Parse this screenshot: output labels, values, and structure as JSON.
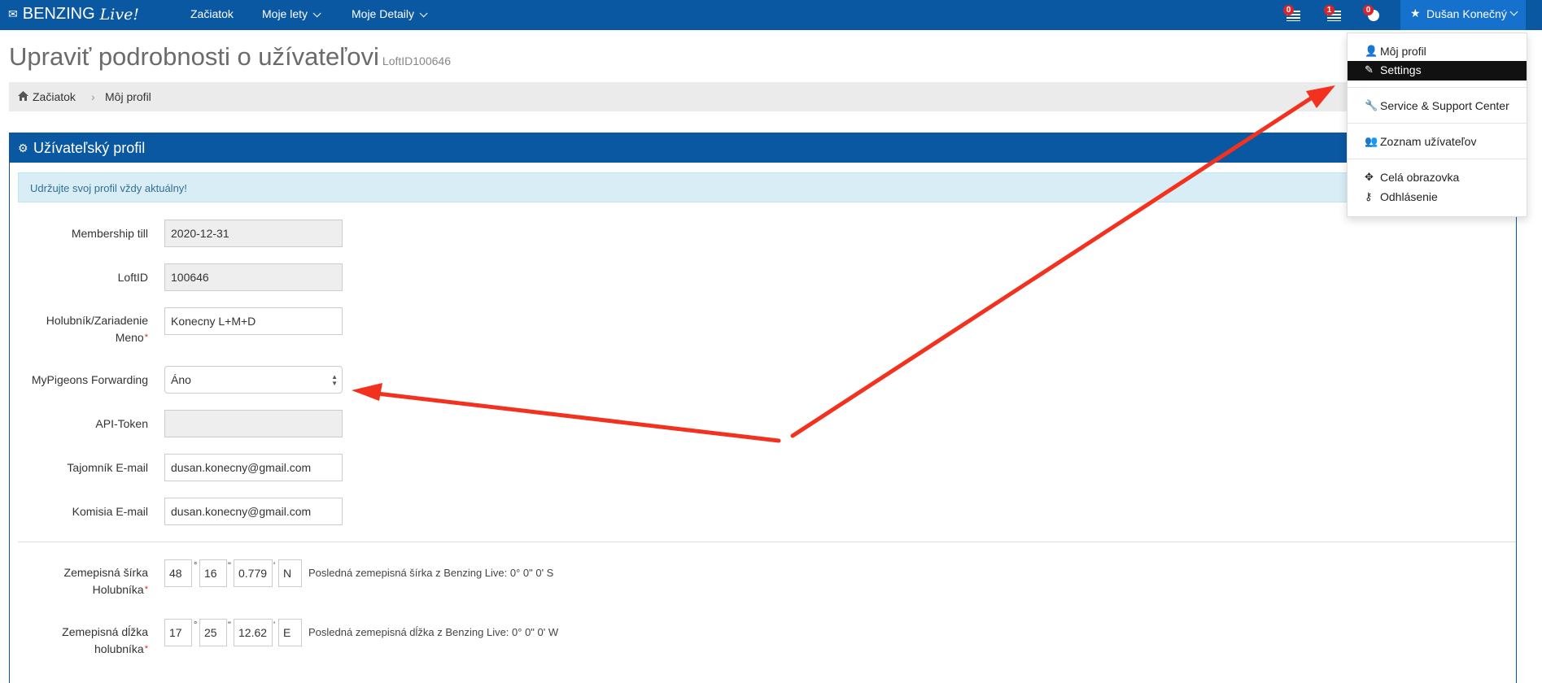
{
  "navbar": {
    "brand": "BENZING",
    "brand_script": "Live!",
    "links": [
      {
        "label": "Začiatok"
      },
      {
        "label": "Moje lety"
      },
      {
        "label": "Moje Detaily"
      }
    ],
    "badges": [
      "0",
      "1",
      "0"
    ],
    "user_name": "Dušan Konečný"
  },
  "page": {
    "title": "Upraviť podrobnosti o užívateľovi",
    "subtitle": "LoftID100646"
  },
  "breadcrumb": {
    "home": "Začiatok",
    "separator": "›",
    "current": "Môj profil"
  },
  "panel": {
    "title": "Užívateľský profil",
    "alert": "Udržujte svoj profil vždy aktuálny!"
  },
  "form": {
    "membership_label": "Membership till",
    "membership_value": "2020-12-31",
    "loftid_label": "LoftID",
    "loftid_value": "100646",
    "loft_name_label_1": "Holubník/Zariadenie",
    "loft_name_label_2": "Meno",
    "loft_name_value": "Konecny L+M+D",
    "forwarding_label": "MyPigeons Forwarding",
    "forwarding_value": "Áno",
    "api_label": "API-Token",
    "api_value": "",
    "secretary_label": "Tajomník E-mail",
    "secretary_value": "dusan.konecny@gmail.com",
    "commission_label": "Komisia E-mail",
    "commission_value": "dusan.konecny@gmail.com",
    "required_mark": "*"
  },
  "latitude": {
    "label_1": "Zemepisná šírka",
    "label_2": "Holubníka",
    "deg": "48",
    "min": "16",
    "sec": "0.779",
    "dir": "N",
    "note": "Posledná zemepisná šírka z Benzing Live: 0° 0\" 0' S"
  },
  "longitude": {
    "label_1": "Zemepisná dĺžka",
    "label_2": "holubníka",
    "deg": "17",
    "min": "25",
    "sec": "12.62",
    "dir": "E",
    "note": "Posledná zemepisná dĺžka z Benzing Live: 0° 0\" 0' W"
  },
  "symbols": {
    "degree": "°",
    "minute": "\"",
    "second": "'"
  },
  "user_menu": {
    "items": [
      {
        "label": "Môj profil",
        "icon": "user-icon"
      },
      {
        "label": "Settings",
        "icon": "edit-icon"
      },
      {
        "label": "Service & Support Center",
        "icon": "wrench-icon"
      },
      {
        "label": "Zoznam užívateľov",
        "icon": "users-icon"
      },
      {
        "label": "Celá obrazovka",
        "icon": "arrows-move-icon"
      },
      {
        "label": "Odhlásenie",
        "icon": "key-icon"
      }
    ]
  },
  "colors": {
    "navbar": "#0b58a2",
    "user_nav": "#1671cc",
    "annotation_arrow": "#f2321f",
    "badge": "#d9242b"
  }
}
